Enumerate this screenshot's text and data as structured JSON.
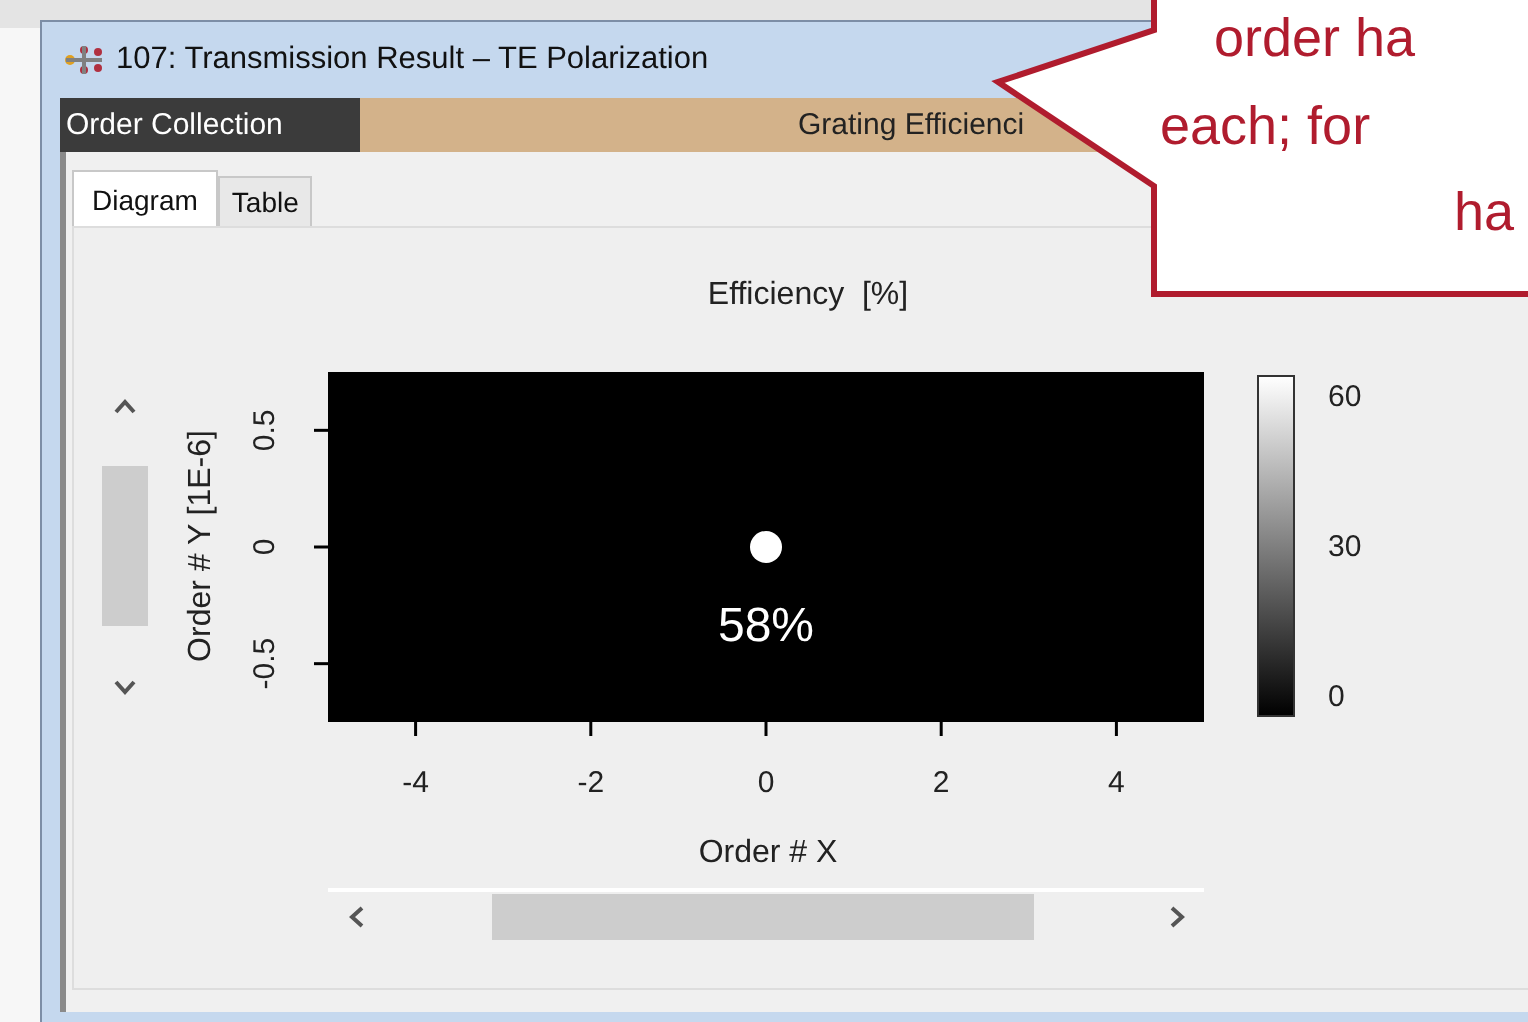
{
  "window": {
    "title": "107: Transmission Result – TE Polarization"
  },
  "header": {
    "collection_label": "Order Collection",
    "section_label": "Grating Efficienci"
  },
  "tabs": [
    {
      "label": "Diagram",
      "selected": true
    },
    {
      "label": "Table",
      "selected": false
    }
  ],
  "chart": {
    "chart_data": {
      "type": "scatter",
      "title": "Efficiency  [%]",
      "xlabel": "Order # X",
      "ylabel": "Order # Y [1E-6]",
      "xlim": [
        -5,
        5
      ],
      "ylim": [
        -0.75,
        0.75
      ],
      "xticks": [
        -4,
        -2,
        0,
        2,
        4
      ],
      "yticks": [
        -0.5,
        0,
        0.5
      ],
      "x": [
        0
      ],
      "series": [
        {
          "color": "#ffffff",
          "values": [
            0
          ]
        }
      ],
      "value_labels": [
        "58%"
      ]
    },
    "colorbar": {
      "labels": [
        "60",
        "30",
        "0"
      ]
    }
  },
  "callout": {
    "lines": [
      "order ha",
      "each; for",
      "ha"
    ]
  }
}
